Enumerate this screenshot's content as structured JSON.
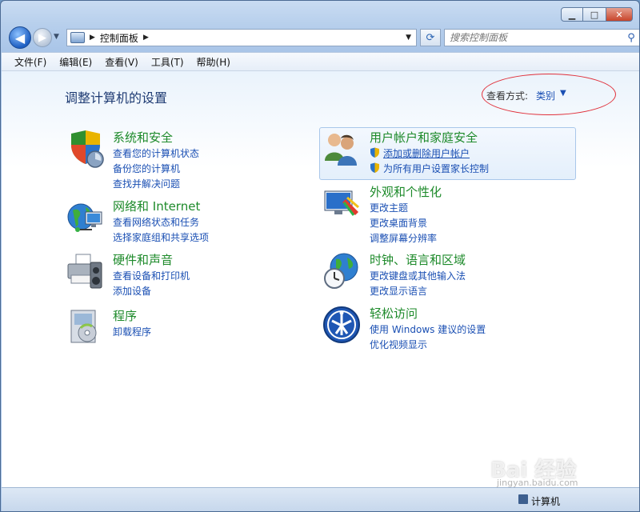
{
  "window": {
    "caption": {
      "minimize": "▁",
      "maximize": "□",
      "close": "✕"
    }
  },
  "nav": {
    "back": "◀",
    "forward": "▶",
    "history": "▼",
    "address_separator": "▶",
    "address_text": "控制面板",
    "address_separator_after": "▶",
    "address_dropdown": "▼",
    "refresh": "⟳",
    "search_placeholder": "搜索控制面板",
    "search_glyph": "⚲"
  },
  "menu": [
    {
      "label": "文件(F)"
    },
    {
      "label": "编辑(E)"
    },
    {
      "label": "查看(V)"
    },
    {
      "label": "工具(T)"
    },
    {
      "label": "帮助(H)"
    }
  ],
  "content": {
    "page_title": "调整计算机的设置",
    "view_by_label": "查看方式:",
    "view_by_value": "类别",
    "view_by_arrow": "▼"
  },
  "categories": {
    "system": {
      "title": "系统和安全",
      "links": [
        "查看您的计算机状态",
        "备份您的计算机",
        "查找并解决问题"
      ]
    },
    "network": {
      "title": "网络和 Internet",
      "links": [
        "查看网络状态和任务",
        "选择家庭组和共享选项"
      ]
    },
    "hardware": {
      "title": "硬件和声音",
      "links": [
        "查看设备和打印机",
        "添加设备"
      ]
    },
    "programs": {
      "title": "程序",
      "links": [
        "卸载程序"
      ]
    },
    "users": {
      "title": "用户帐户和家庭安全",
      "links": [
        "添加或删除用户帐户",
        "为所有用户设置家长控制"
      ]
    },
    "appearance": {
      "title": "外观和个性化",
      "links": [
        "更改主题",
        "更改桌面背景",
        "调整屏幕分辨率"
      ]
    },
    "clock": {
      "title": "时钟、语言和区域",
      "links": [
        "更改键盘或其他输入法",
        "更改显示语言"
      ]
    },
    "ease": {
      "title": "轻松访问",
      "links": [
        "使用 Windows 建议的设置",
        "优化视频显示"
      ]
    }
  },
  "statusbar": {
    "text": "计算机"
  },
  "watermark": {
    "main": "Bai 经验",
    "sub": "jingyan.baidu.com"
  }
}
